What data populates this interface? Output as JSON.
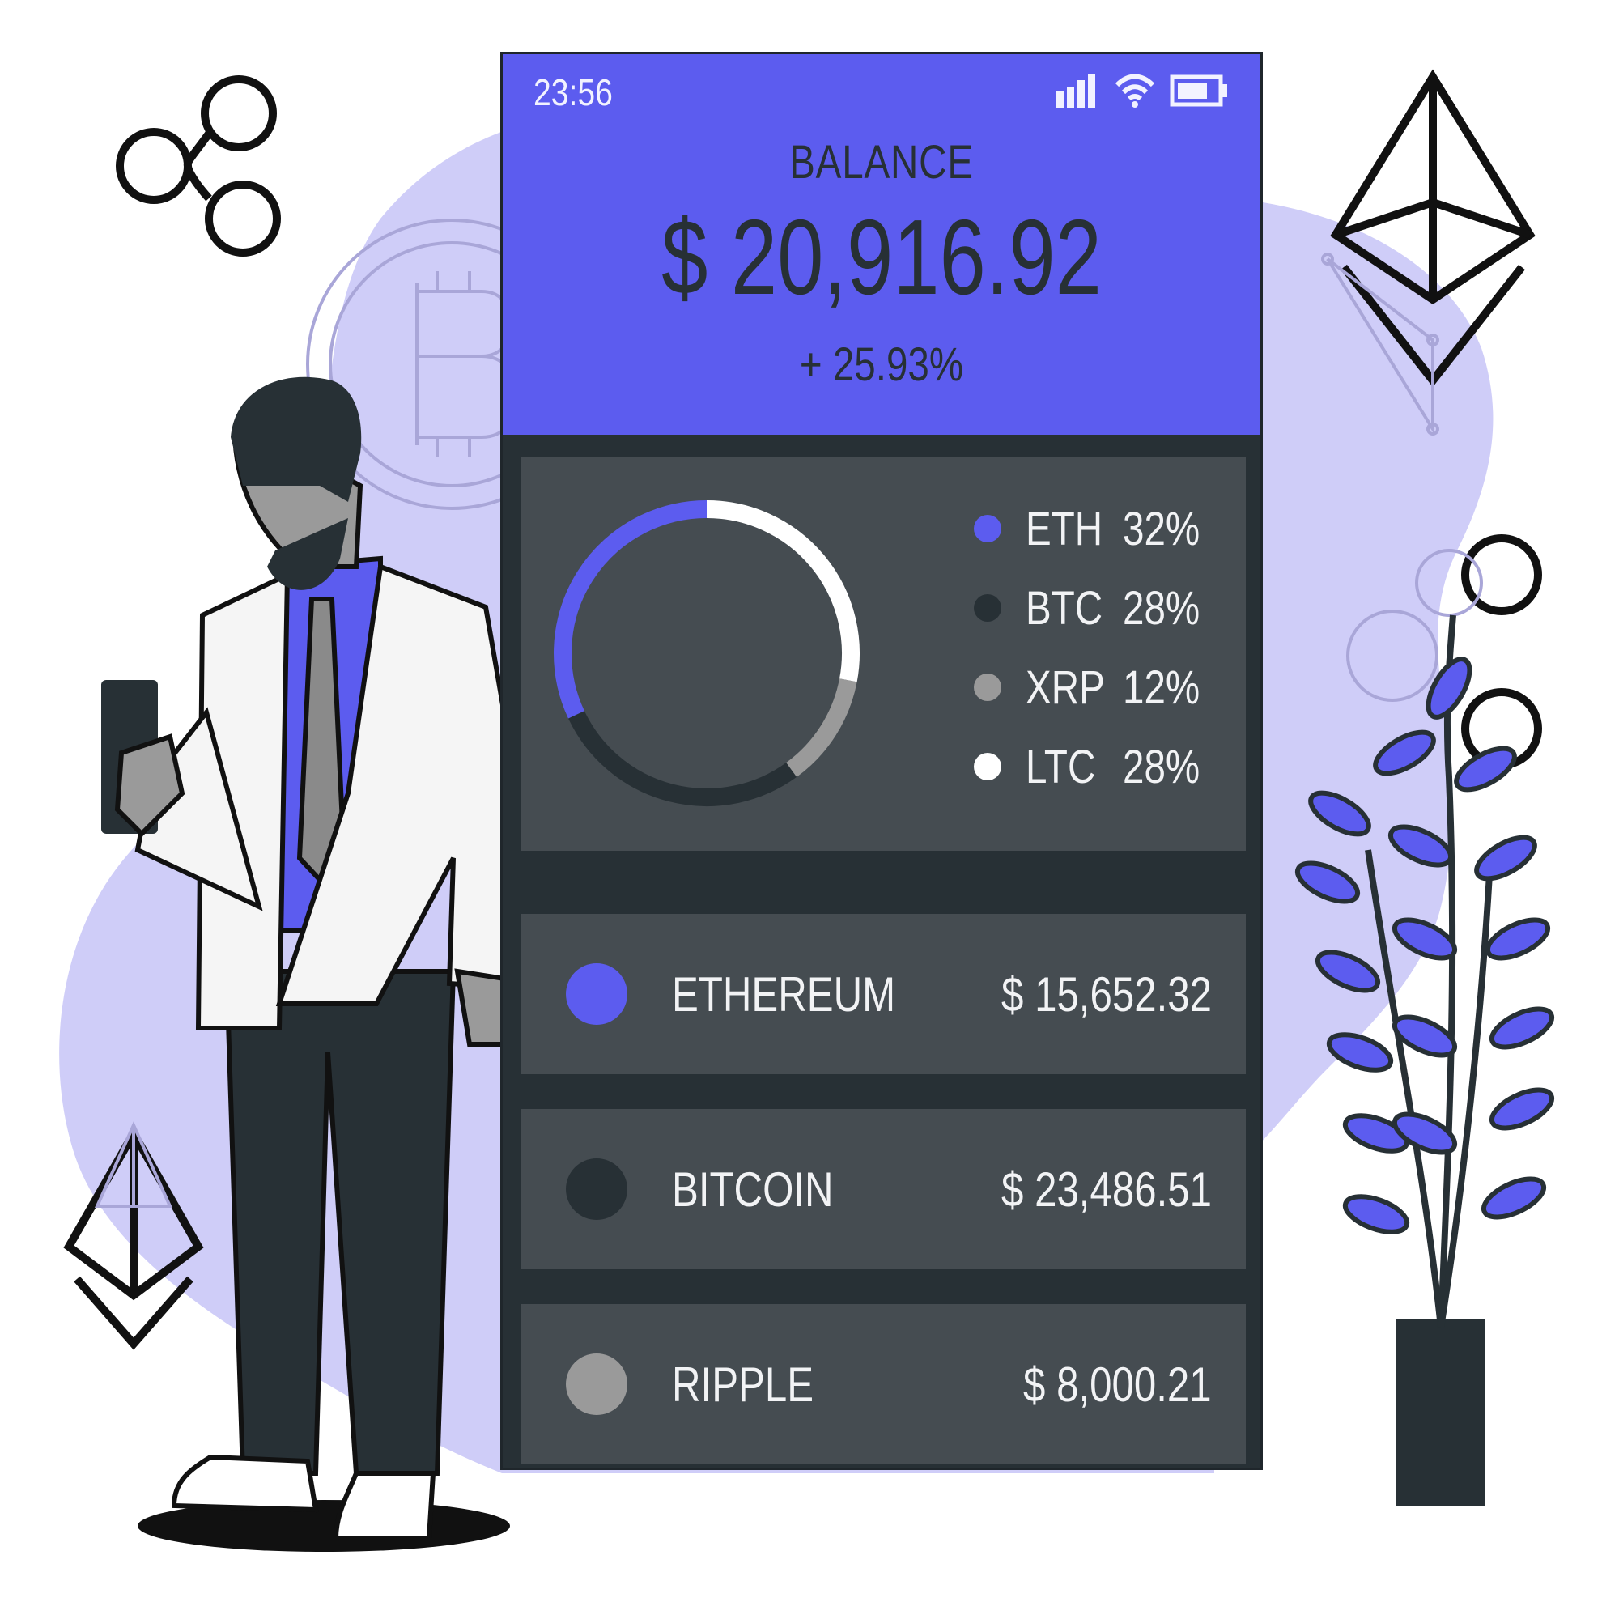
{
  "status_bar": {
    "time": "23:56"
  },
  "balance": {
    "label": "BALANCE",
    "amount": "$ 20,916.92",
    "change": "+ 25.93%"
  },
  "allocation": [
    {
      "symbol": "ETH",
      "percent_label": "32%",
      "percent": 32,
      "color": "#5c5cef"
    },
    {
      "symbol": "BTC",
      "percent_label": "28%",
      "percent": 28,
      "color": "#273035"
    },
    {
      "symbol": "XRP",
      "percent_label": "12%",
      "percent": 12,
      "color": "#9a9a9a"
    },
    {
      "symbol": "LTC",
      "percent_label": "28%",
      "percent": 28,
      "color": "#ffffff"
    }
  ],
  "assets": [
    {
      "name": "ETHEREUM",
      "value": "$ 15,652.32",
      "color": "#5c5cef"
    },
    {
      "name": "BITCOIN",
      "value": "$ 23,486.51",
      "color": "#273035"
    },
    {
      "name": "RIPPLE",
      "value": "$ 8,000.21",
      "color": "#9a9a9a"
    }
  ],
  "colors": {
    "accent": "#5c5cef",
    "dark": "#273035",
    "card": "#454c51",
    "lavender": "#cfcdf8"
  },
  "icons": [
    "ripple-logo-icon",
    "ethereum-logo-icon",
    "bitcoin-coin-icon",
    "signal-icon",
    "wifi-icon",
    "battery-icon"
  ]
}
